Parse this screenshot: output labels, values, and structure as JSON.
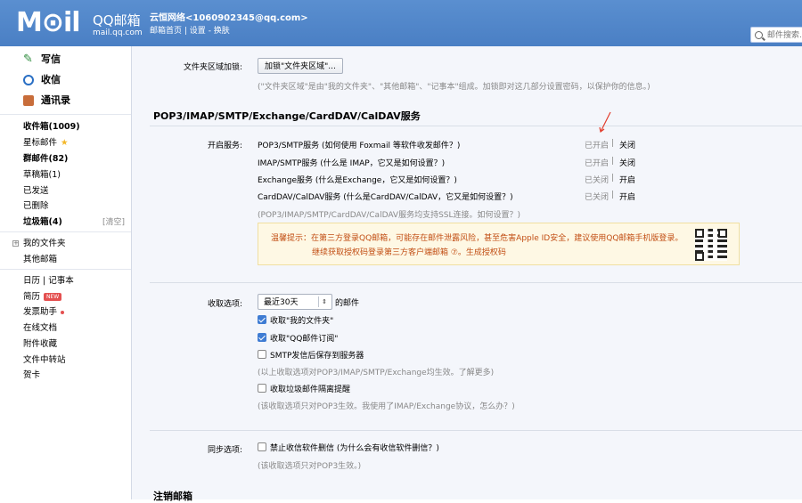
{
  "header": {
    "logo_mail": "M⊙il",
    "logo_qq": "QQ邮箱",
    "logo_domain": "mail.qq.com",
    "user": "云恒网络<1060902345@qq.com>",
    "links": [
      "邮箱首页",
      "设置",
      "换肤"
    ],
    "search_placeholder": "邮件搜索..."
  },
  "sidebar": {
    "primary": [
      {
        "label": "写信",
        "icon": "pencil-icon"
      },
      {
        "label": "收信",
        "icon": "inbox-icon"
      },
      {
        "label": "通讯录",
        "icon": "contacts-icon"
      }
    ],
    "folders": [
      {
        "label": "收件箱(1009)",
        "bold": true
      },
      {
        "label": "星标邮件",
        "star": true
      },
      {
        "label": "群邮件(82)",
        "bold": true
      },
      {
        "label": "草稿箱(1)"
      },
      {
        "label": "已发送"
      },
      {
        "label": "已删除"
      },
      {
        "label": "垃圾箱(4)",
        "bold": true,
        "extra": "[清空]"
      }
    ],
    "my_folders": "我的文件夹",
    "other_mailbox": "其他邮箱",
    "calendar": "日历",
    "notes": "记事本",
    "resume": "简历",
    "resume_badge": "NEW",
    "invoice": "发票助手",
    "tools": [
      "在线文档",
      "附件收藏",
      "文件中转站",
      "贺卡"
    ]
  },
  "main": {
    "folder_lock_label": "文件夹区域加锁:",
    "folder_lock_button": "加锁\"文件夹区域\"...",
    "folder_lock_desc": "(\"文件夹区域\"是由\"我的文件夹\"、\"其他邮箱\"、\"记事本\"组成。加锁即对这几部分设置密码，以保护你的信息。)",
    "section_title": "POP3/IMAP/SMTP/Exchange/CardDAV/CalDAV服务",
    "services_label": "开启服务:",
    "services": [
      {
        "name": "POP3/SMTP服务 (如何使用 Foxmail 等软件收发邮件？)",
        "state": "已开启",
        "action": "关闭"
      },
      {
        "name": "IMAP/SMTP服务 (什么是 IMAP，它又是如何设置？)",
        "state": "已开启",
        "action": "关闭"
      },
      {
        "name": "Exchange服务 (什么是Exchange，它又是如何设置？)",
        "state": "已关闭",
        "action": "开启"
      },
      {
        "name": "CardDAV/CalDAV服务 (什么是CardDAV/CalDAV，它又是如何设置？)",
        "state": "已关闭",
        "action": "开启"
      }
    ],
    "ssl_note": "(POP3/IMAP/SMTP/CardDAV/CalDAV服务均支持SSL连接。如何设置？)",
    "tip_line1": "温馨提示：在第三方登录QQ邮箱，可能存在邮件泄露风险，甚至危害Apple ID安全，建议使用QQ邮箱手机版登录。",
    "tip_line2": "继续获取授权码登录第三方客户端邮箱 ⑦。生成授权码",
    "receive_label": "收取选项:",
    "receive_select": "最近30天",
    "receive_suffix": "的邮件",
    "receive_options": [
      {
        "label": "收取\"我的文件夹\"",
        "checked": true
      },
      {
        "label": "收取\"QQ邮件订阅\"",
        "checked": true
      },
      {
        "label": "SMTP发信后保存到服务器",
        "checked": false
      }
    ],
    "receive_note1": "(以上收取选项对POP3/IMAP/SMTP/Exchange均生效。了解更多)",
    "spam_option": "收取垃圾邮件隔离提醒",
    "receive_note2": "(该收取选项只对POP3生效。我使用了IMAP/Exchange协议，怎么办？)",
    "sync_label": "同步选项:",
    "sync_option": "禁止收信软件删信 (为什么会有收信软件删信？)",
    "sync_note": "(该收取选项只对POP3生效。)",
    "cancel_title": "注销邮箱"
  }
}
